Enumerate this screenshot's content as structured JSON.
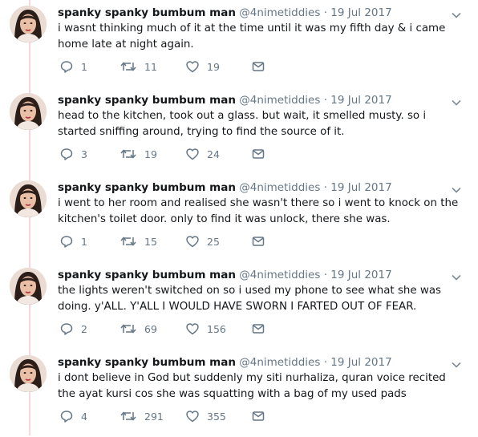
{
  "user": {
    "name": "spanky spanky bumbum man",
    "handle": "@4nimetiddies",
    "date": "19 Jul 2017"
  },
  "tweets": [
    {
      "text": "i wasnt thinking much of it at the time until it was my fifth day & i came home late at night again.",
      "replies": "1",
      "retweets": "11",
      "likes": "19"
    },
    {
      "text": "head to the kitchen, took out a glass. but wait, it smelled musty. so i started sniffing around, trying to find the source of it.",
      "replies": "3",
      "retweets": "19",
      "likes": "24"
    },
    {
      "text": "i went to her room and realised she wasn't there so i went to knock on the kitchen's toilet door. only to find it was unlock, there she was.",
      "replies": "1",
      "retweets": "15",
      "likes": "25"
    },
    {
      "text": "the lights weren't switched on so i used my phone to see what she was doing. y'ALL. Y'ALL I WOULD HAVE SWORN I FARTED OUT OF FEAR.",
      "replies": "2",
      "retweets": "69",
      "likes": "156"
    },
    {
      "text": "i dont believe in God but suddenly my siti nurhaliza, quran voice recited the ayat kursi cos she was squatting with a bag of my used pads",
      "replies": "4",
      "retweets": "291",
      "likes": "355"
    }
  ],
  "colors": {
    "thread_line": "#f7d7dc",
    "icon": "#657786",
    "text": "#14171a"
  },
  "icons": [
    "reply-icon",
    "retweet-icon",
    "like-icon",
    "direct-message-icon",
    "caret-down-icon"
  ]
}
